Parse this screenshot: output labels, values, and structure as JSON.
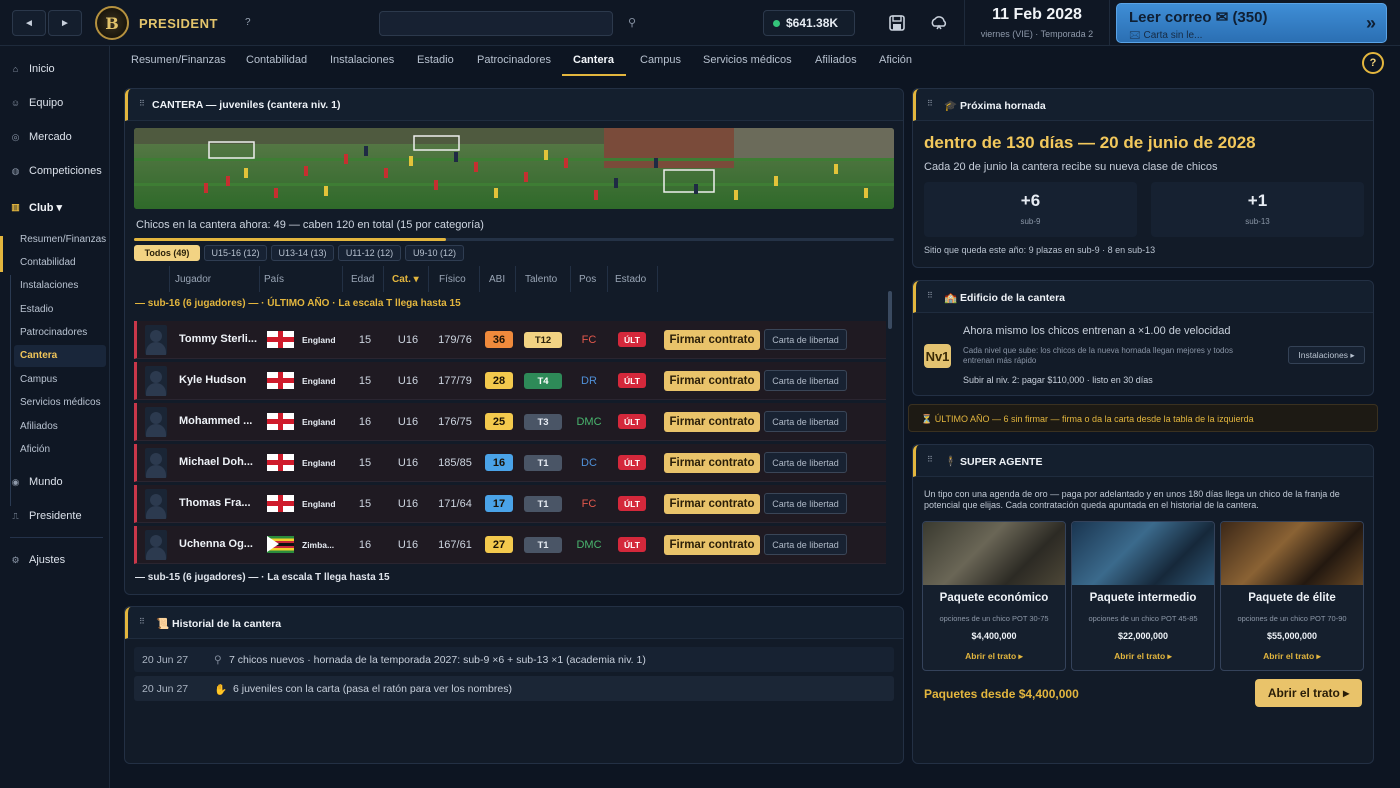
{
  "app": {
    "brand": "PRESIDENT",
    "logo_letter": "B",
    "help": "?"
  },
  "topbar": {
    "money": "$641.38K",
    "date": "11 Feb 2028",
    "date_sub": "viernes (VIE) · Temporada 2",
    "mail_title": "Leer correo ✉ (350)",
    "mail_sub": "🖂 Carta sin le...",
    "mail_arrow": "»"
  },
  "sidebar": {
    "items": [
      {
        "label": "Inicio",
        "icon": "home-icon"
      },
      {
        "label": "Equipo",
        "icon": "team-icon"
      },
      {
        "label": "Mercado",
        "icon": "market-icon"
      },
      {
        "label": "Competiciones",
        "icon": "trophy-icon"
      },
      {
        "label": "Club ▾",
        "icon": "club-icon"
      },
      {
        "label": "Mundo",
        "icon": "globe-icon"
      },
      {
        "label": "Presidente",
        "icon": "person-icon"
      },
      {
        "label": "Ajustes",
        "icon": "gear-icon"
      }
    ],
    "club_sub": [
      "Resumen/Finanzas",
      "Contabilidad",
      "Instalaciones",
      "Estadio",
      "Patrocinadores",
      "Cantera",
      "Campus",
      "Servicios médicos",
      "Afiliados",
      "Afición"
    ]
  },
  "tabs": [
    "Resumen/Finanzas",
    "Contabilidad",
    "Instalaciones",
    "Estadio",
    "Patrocinadores",
    "Cantera",
    "Campus",
    "Servicios médicos",
    "Afiliados",
    "Afición"
  ],
  "cantera": {
    "title": "CANTERA — juveniles (cantera niv. 1)",
    "stats": "Chicos en la cantera ahora: 49 — caben 120 en total (15 por categoría)",
    "capacity_fraction": 0.41,
    "filters": [
      "Todos (49)",
      "U15-16 (12)",
      "U13-14 (13)",
      "U11-12 (12)",
      "U9-10 (12)"
    ],
    "columns": [
      "Jugador",
      "País",
      "Edad",
      "Cat. ▾",
      "Físico",
      "ABI",
      "Talento",
      "Pos",
      "Estado"
    ],
    "group1": "— sub-16 (6 jugadores) — · ÚLTIMO AÑO · La escala T llega hasta 15",
    "group2": "— sub-15 (6 jugadores) — · La escala T llega hasta 15",
    "sign_label": "Firmar contrato",
    "release_label": "Carta de libertad",
    "rows": [
      {
        "name": "Tommy Sterli...",
        "country": "England",
        "flag": "eng",
        "age": "15",
        "cat": "U16",
        "phys": "179/76",
        "abi": "36",
        "abi_color": "#f08a3c",
        "tal": "T12",
        "tal_bg": "#f2d383",
        "tal_fg": "#2a210b",
        "pos": "FC",
        "pos_color": "#e2584c",
        "status": "ÚLT"
      },
      {
        "name": "Kyle Hudson",
        "country": "England",
        "flag": "eng",
        "age": "15",
        "cat": "U16",
        "phys": "177/79",
        "abi": "28",
        "abi_color": "#f3c94d",
        "tal": "T4",
        "tal_bg": "#2e8a58",
        "tal_fg": "#ffffff",
        "pos": "DR",
        "pos_color": "#4f90d8",
        "status": "ÚLT"
      },
      {
        "name": "Mohammed ...",
        "country": "England",
        "flag": "eng",
        "age": "16",
        "cat": "U16",
        "phys": "176/75",
        "abi": "25",
        "abi_color": "#f3c94d",
        "tal": "T3",
        "tal_bg": "#4a5566",
        "tal_fg": "#e6ebf2",
        "pos": "DMC",
        "pos_color": "#49b56e",
        "status": "ÚLT"
      },
      {
        "name": "Michael Doh...",
        "country": "England",
        "flag": "eng",
        "age": "15",
        "cat": "U16",
        "phys": "185/85",
        "abi": "16",
        "abi_color": "#4aa3e8",
        "tal": "T1",
        "tal_bg": "#4a5566",
        "tal_fg": "#e6ebf2",
        "pos": "DC",
        "pos_color": "#4f90d8",
        "status": "ÚLT"
      },
      {
        "name": "Thomas Fra...",
        "country": "England",
        "flag": "eng",
        "age": "15",
        "cat": "U16",
        "phys": "171/64",
        "abi": "17",
        "abi_color": "#4aa3e8",
        "tal": "T1",
        "tal_bg": "#4a5566",
        "tal_fg": "#e6ebf2",
        "pos": "FC",
        "pos_color": "#e2584c",
        "status": "ÚLT"
      },
      {
        "name": "Uchenna Og...",
        "country": "Zimba...",
        "flag": "zim",
        "age": "16",
        "cat": "U16",
        "phys": "167/61",
        "abi": "27",
        "abi_color": "#f3c94d",
        "tal": "T1",
        "tal_bg": "#4a5566",
        "tal_fg": "#e6ebf2",
        "pos": "DMC",
        "pos_color": "#49b56e",
        "status": "ÚLT"
      }
    ]
  },
  "history": {
    "title": "📜 Historial de la cantera",
    "rows": [
      {
        "date": "20 Jun 27",
        "icon": "⚲",
        "text": "7 chicos nuevos · hornada de la temporada 2027: sub-9 ×6 + sub-13 ×1 (academia niv. 1)"
      },
      {
        "date": "20 Jun 27",
        "icon": "✋",
        "text": "6 juveniles con la carta (pasa el ratón para ver los nombres)"
      }
    ]
  },
  "next": {
    "title": "🎓 Próxima hornada",
    "big": "dentro de 130 días — 20 de junio de 2028",
    "sub": "Cada 20 de junio la cantera recibe su nueva clase de chicos",
    "boxes": [
      {
        "n": "+6",
        "l": "sub-9"
      },
      {
        "n": "+1",
        "l": "sub-13"
      }
    ],
    "note": "Sitio que queda este año: 9 plazas en sub-9 · 8 en sub-13"
  },
  "building": {
    "title": "🏫 Edificio de la cantera",
    "level": "Nv1",
    "speed": "Ahora mismo los chicos entrenan a ×1.00 de velocidad",
    "desc": "Cada nivel que sube: los chicos de la nueva hornada llegan mejores y todos entrenan más rápido",
    "cost": "Subir al niv. 2: pagar $110,000 · listo en 30 días",
    "btn": "Instalaciones ▸"
  },
  "warning": "⏳ ÚLTIMO AÑO — 6 sin firmar — firma o da la carta desde la tabla de la izquierda",
  "agent": {
    "title": "🕴 SUPER AGENTE",
    "desc": "Un tipo con una agenda de oro — paga por adelantado y en unos 180 días llega un chico de la franja de potencial que elijas. Cada contratación queda apuntada en el historial de la cantera.",
    "packs": [
      {
        "title": "Paquete económico",
        "odds": "opciones de un chico POT 30-75",
        "price": "$4,400,000",
        "link": "Abrir el trato ▸"
      },
      {
        "title": "Paquete intermedio",
        "odds": "opciones de un chico POT 45-85",
        "price": "$22,000,000",
        "link": "Abrir el trato ▸"
      },
      {
        "title": "Paquete de élite",
        "odds": "opciones de un chico POT 70-90",
        "price": "$55,000,000",
        "link": "Abrir el trato ▸"
      }
    ],
    "from": "Paquetes desde $4,400,000",
    "deal": "Abrir el trato ▸"
  }
}
